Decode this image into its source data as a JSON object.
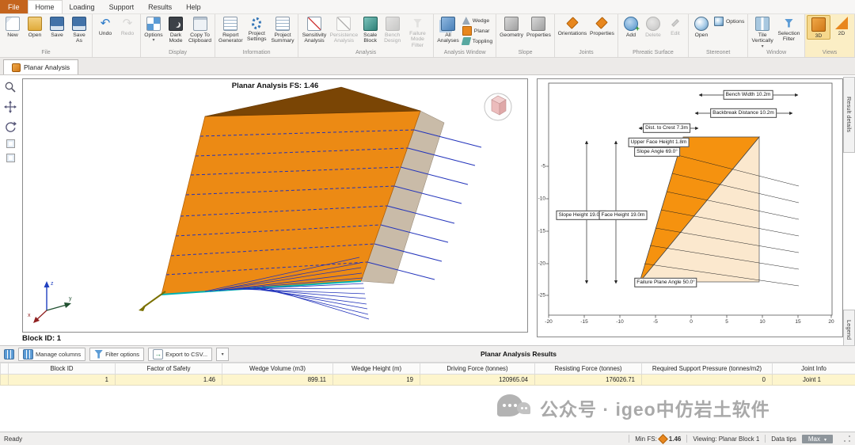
{
  "menubar": {
    "file": "File",
    "items": [
      "Home",
      "Loading",
      "Support",
      "Results",
      "Help"
    ]
  },
  "ribbon": {
    "groups": [
      {
        "label": "File",
        "buttons": [
          "New",
          "Open",
          "Save",
          "Save As"
        ]
      },
      {
        "label": "",
        "buttons": [
          "Undo",
          "Redo"
        ]
      },
      {
        "label": "Display",
        "buttons": [
          "Options",
          "Dark Mode",
          "Copy To Clipboard"
        ]
      },
      {
        "label": "Information",
        "buttons": [
          "Report Generator",
          "Project Settings",
          "Project Summary"
        ]
      },
      {
        "label": "Analysis",
        "buttons": [
          "Sensitivity Analysis",
          "Persistence Analysis",
          "Scale Block",
          "Bench Design",
          "Failure Mode Filter"
        ]
      },
      {
        "label": "Analysis Window",
        "buttons": [
          "All Analyses",
          "Wedge",
          "Planar",
          "Toppling"
        ]
      },
      {
        "label": "Slope",
        "buttons": [
          "Geometry",
          "Properties"
        ]
      },
      {
        "label": "Joints",
        "buttons": [
          "Orientations",
          "Properties"
        ]
      },
      {
        "label": "Phreatic Surface",
        "buttons": [
          "Add",
          "Delete",
          "Edit"
        ]
      },
      {
        "label": "Stereonet",
        "buttons": [
          "Open",
          "Options"
        ]
      },
      {
        "label": "Window",
        "buttons": [
          "Tile Vertically",
          "Selection Filter"
        ]
      },
      {
        "label": "Views",
        "buttons": [
          "3D",
          "2D"
        ]
      }
    ]
  },
  "doc_tab": "Planar Analysis",
  "view3d": {
    "title": "Planar Analysis FS: 1.46",
    "block_id": "Block ID: 1",
    "axis": {
      "x": "x",
      "y": "y",
      "z": "z"
    }
  },
  "view2d": {
    "annotations": {
      "bench_width": "Bench Width 10.2m",
      "backbreak": "Backbreak Distance 10.2m",
      "dist_crest": "Dist. to Crest 7.3m",
      "upper_face": "Upper Face Height 1.8m",
      "slope_angle": "Slope Angle 69.0°",
      "slope_height": "Slope Height 19.0m",
      "face_height": "Face Height 19.0m",
      "failure_angle": "Failure Plane Angle 50.0°"
    },
    "x_ticks": [
      "-20",
      "-15",
      "-10",
      "-5",
      "0",
      "5",
      "10",
      "15",
      "20"
    ],
    "y_ticks": [
      "-5",
      "-10",
      "-15",
      "-20",
      "-25"
    ]
  },
  "side_tabs": {
    "top": "Result details",
    "bottom": "Legend"
  },
  "results": {
    "toolbar": {
      "manage": "Manage columns",
      "filter": "Filter options",
      "export": "Export to CSV...",
      "title": "Planar Analysis Results"
    },
    "columns": [
      "Block ID",
      "Factor of Safety",
      "Wedge Volume (m3)",
      "Wedge Height (m)",
      "Driving Force (tonnes)",
      "Resisting Force (tonnes)",
      "Required Support Pressure (tonnes/m2)",
      "Joint Info"
    ],
    "rows": [
      [
        "1",
        "1.46",
        "899.11",
        "19",
        "120965.04",
        "176026.71",
        "0",
        "Joint 1"
      ]
    ]
  },
  "watermark": {
    "text": "公众号 · igeo中仿岩土软件"
  },
  "statusbar": {
    "ready": "Ready",
    "min_fs_label": "Min FS:",
    "min_fs_value": "1.46",
    "viewing": "Viewing: Planar Block 1",
    "data_tips": "Data tips",
    "max": "Max"
  },
  "colors": {
    "accent_orange": "#e8871e",
    "row_highlight": "#fdf5cd",
    "joint_blue": "#2233bb"
  }
}
